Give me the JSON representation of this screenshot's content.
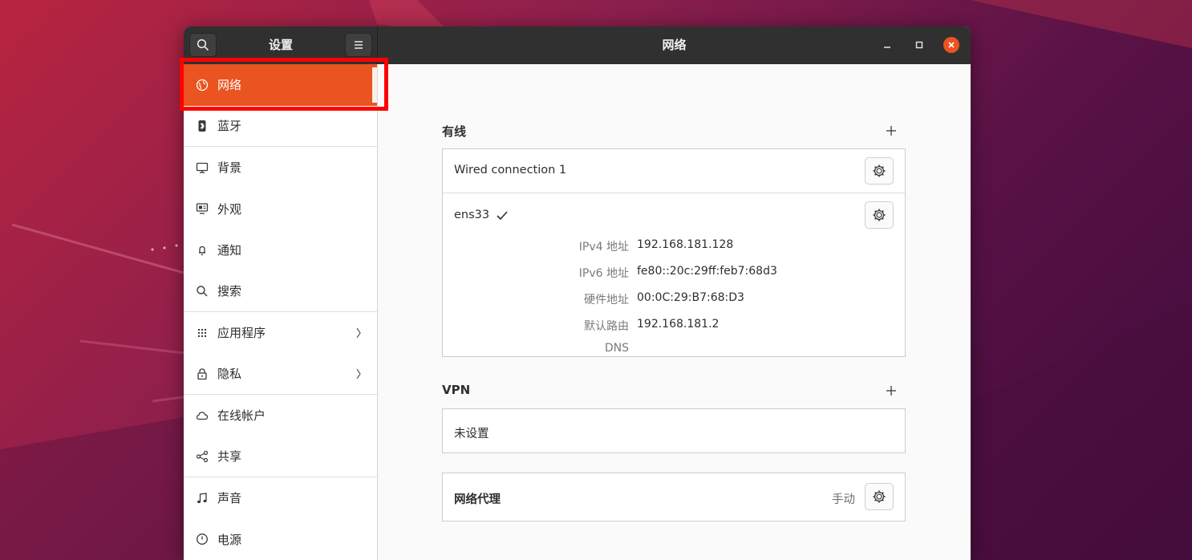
{
  "window": {
    "sidebar_title": "设置",
    "main_title": "网络"
  },
  "colors": {
    "accent": "#e95420",
    "titlebar": "#303030",
    "close_button": "#e95420",
    "highlight_box": "#ff0000"
  },
  "sidebar": {
    "items": [
      {
        "label": "网络",
        "icon": "globe-icon"
      },
      {
        "label": "蓝牙",
        "icon": "bluetooth-icon"
      },
      {
        "label": "背景",
        "icon": "display-icon"
      },
      {
        "label": "外观",
        "icon": "appearance-icon"
      },
      {
        "label": "通知",
        "icon": "bell-icon"
      },
      {
        "label": "搜索",
        "icon": "search-icon"
      },
      {
        "label": "应用程序",
        "icon": "apps-grid-icon"
      },
      {
        "label": "隐私",
        "icon": "lock-icon"
      },
      {
        "label": "在线帐户",
        "icon": "cloud-icon"
      },
      {
        "label": "共享",
        "icon": "share-icon"
      },
      {
        "label": "声音",
        "icon": "music-note-icon"
      },
      {
        "label": "电源",
        "icon": "power-icon"
      }
    ]
  },
  "wired": {
    "heading": "有线",
    "connection_name": "Wired connection 1",
    "device_name": "ens33",
    "details": [
      {
        "label": "IPv4 地址",
        "value": "192.168.181.128"
      },
      {
        "label": "IPv6 地址",
        "value": "fe80::20c:29ff:feb7:68d3"
      },
      {
        "label": "硬件地址",
        "value": "00:0C:29:B7:68:D3"
      },
      {
        "label": "默认路由",
        "value": "192.168.181.2"
      },
      {
        "label": "DNS",
        "value": ""
      }
    ]
  },
  "vpn": {
    "heading": "VPN",
    "empty_label": "未设置"
  },
  "proxy": {
    "label": "网络代理",
    "status": "手动"
  }
}
